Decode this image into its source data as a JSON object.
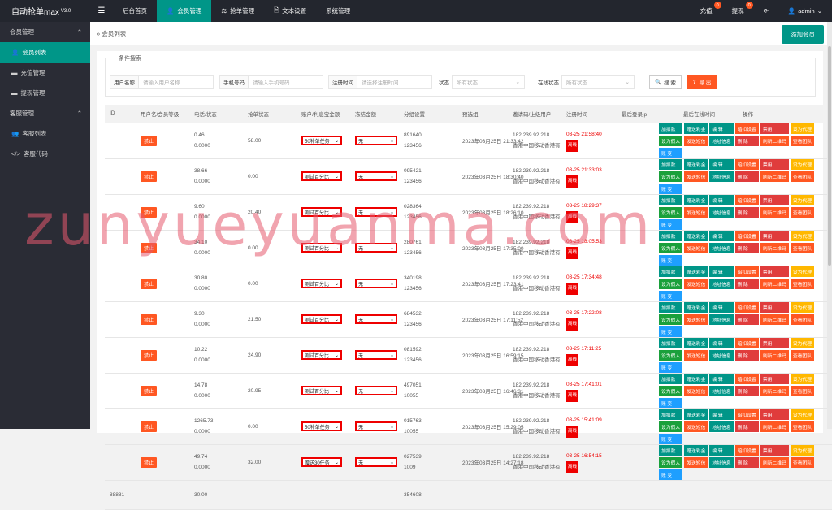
{
  "app": {
    "title": "自动抢单max",
    "version": "V3.0"
  },
  "topnav": [
    "后台首页",
    "会员管理",
    "抢单管理",
    "文本设置",
    "系统管理"
  ],
  "topright": {
    "recharge": "充值",
    "recharge_badge": "0",
    "withdraw": "提现",
    "withdraw_badge": "0",
    "user": "admin"
  },
  "sidebar": {
    "group1": "会员管理",
    "items1": [
      "会员列表",
      "充值管理",
      "提现管理"
    ],
    "group2": "客服管理",
    "items2": [
      "客服列表",
      "客服代码"
    ]
  },
  "page": {
    "breadcrumb": "会员列表",
    "add_button": "添加会员"
  },
  "search": {
    "legend": "条件搜索",
    "username_label": "用户名称",
    "username_placeholder": "请输入用户名称",
    "phone_label": "手机号码",
    "phone_placeholder": "请输入手机号码",
    "regtime_label": "注册时间",
    "regtime_placeholder": "请选择注册时间",
    "status_label": "状态",
    "status_value": "所有状态",
    "online_label": "在线状态",
    "online_value": "所有状态",
    "search_button": "搜 索",
    "export_button": "导 出"
  },
  "table": {
    "headers": [
      "ID",
      "用户名/会员等级",
      "电话/状态",
      "抢单状态",
      "账户/利息宝金额",
      "冻结金额",
      "分组设置",
      "预选组",
      "邀请码/上级用户",
      "注册时间",
      "最后登录ip",
      "最后在线时间",
      "操作"
    ],
    "rows": [
      {
        "id": "",
        "status": "禁止",
        "bal": "0.46",
        "lv": "0.0000",
        "phone": "58.00",
        "task": "50补单任务",
        "grp": "无",
        "code": "891640",
        "inv": "123456",
        "reg": "2023年03月25日 21:33:42",
        "ip": "182.239.92.218",
        "loc": "香港中国移动香港有限",
        "last": "03-25 21:58:40",
        "off": "离线"
      },
      {
        "id": "",
        "status": "禁止",
        "bal": "38.66",
        "lv": "0.0000",
        "phone": "0.00",
        "task": "测试百分比",
        "grp": "无",
        "code": "095421",
        "inv": "123456",
        "reg": "2023年03月25日 18:30:40",
        "ip": "182.239.92.218",
        "loc": "香港中国移动香港有限",
        "last": "03-25 21:33:03",
        "off": "离线"
      },
      {
        "id": "",
        "status": "禁止",
        "bal": "9.60",
        "lv": "0.0000",
        "phone": "20.40",
        "task": "测试百分比",
        "grp": "无",
        "code": "028364",
        "inv": "123456",
        "reg": "2023年03月25日 18:26:10",
        "ip": "182.239.92.218",
        "loc": "香港中国移动香港有限",
        "last": "03-25 18:29:37",
        "off": "离线"
      },
      {
        "id": "",
        "status": "禁止",
        "bal": "34.10",
        "lv": "0.0000",
        "phone": "0.00",
        "task": "测试百分比",
        "grp": "无",
        "code": "280761",
        "inv": "123456",
        "reg": "2023年03月25日 17:35:00",
        "ip": "182.239.92.218",
        "loc": "香港中国移动香港有限",
        "last": "03-25 18:05:53",
        "off": "离线"
      },
      {
        "id": "",
        "status": "禁止",
        "bal": "30.80",
        "lv": "0.0000",
        "phone": "0.00",
        "task": "测试百分比",
        "grp": "无",
        "code": "340198",
        "inv": "123456",
        "reg": "2023年03月25日 17:23:41",
        "ip": "182.239.92.218",
        "loc": "香港中国移动香港有限",
        "last": "03-25 17:34:48",
        "off": "离线"
      },
      {
        "id": "",
        "status": "禁止",
        "bal": "9.30",
        "lv": "0.0000",
        "phone": "21.50",
        "task": "测试百分比",
        "grp": "无",
        "code": "684532",
        "inv": "123456",
        "reg": "2023年03月25日 17:11:52",
        "ip": "182.239.92.218",
        "loc": "香港中国移动香港有限",
        "last": "03-25 17:22:08",
        "off": "离线"
      },
      {
        "id": "",
        "status": "禁止",
        "bal": "10.22",
        "lv": "0.0000",
        "phone": "24.90",
        "task": "测试百分比",
        "grp": "无",
        "code": "081592",
        "inv": "123456",
        "reg": "2023年03月25日 16:59:15",
        "ip": "182.239.92.218",
        "loc": "香港中国移动香港有限",
        "last": "03-25 17:11:25",
        "off": "离线"
      },
      {
        "id": "",
        "status": "禁止",
        "bal": "14.78",
        "lv": "0.0000",
        "phone": "20.95",
        "task": "测试百分比",
        "grp": "无",
        "code": "497051",
        "inv": "10055",
        "reg": "2023年03月25日 16:46:31",
        "ip": "182.239.92.218",
        "loc": "香港中国移动香港有限",
        "last": "03-25 17:41:01",
        "off": "离线"
      },
      {
        "id": "",
        "status": "禁止",
        "bal": "1265.73",
        "lv": "0.0000",
        "phone": "0.00",
        "task": "50补单任务",
        "grp": "无",
        "code": "015763",
        "inv": "10055",
        "reg": "2023年03月25日 15:29:05",
        "ip": "182.239.92.218",
        "loc": "香港中国移动香港有限",
        "last": "03-25 15:41:09",
        "off": "离线"
      },
      {
        "id": "",
        "status": "禁止",
        "bal": "49.74",
        "lv": "0.0000",
        "phone": "32.00",
        "task": "赠送30任务",
        "grp": "无",
        "code": "027539",
        "inv": "1009",
        "reg": "2023年03月25日 14:27:18",
        "ip": "182.239.92.218",
        "loc": "香港中国移动香港有限",
        "last": "03-25 16:54:15",
        "off": "离线"
      },
      {
        "id": "88881",
        "status": "",
        "bal": "30.00",
        "lv": "",
        "phone": "",
        "task": "",
        "grp": "",
        "code": "354608",
        "inv": "",
        "reg": "",
        "ip": "",
        "loc": "",
        "last": "",
        "off": ""
      }
    ],
    "ops": [
      "加扣款",
      "赠送彩金",
      "编 辑",
      "暗扣设置",
      "禁用",
      "设为代理",
      "设为假人",
      "发送短信",
      "地址信息",
      "删 除",
      "刷新二维码",
      "查看团队",
      "账 变"
    ]
  },
  "watermark": "zunyueyuanma.com"
}
